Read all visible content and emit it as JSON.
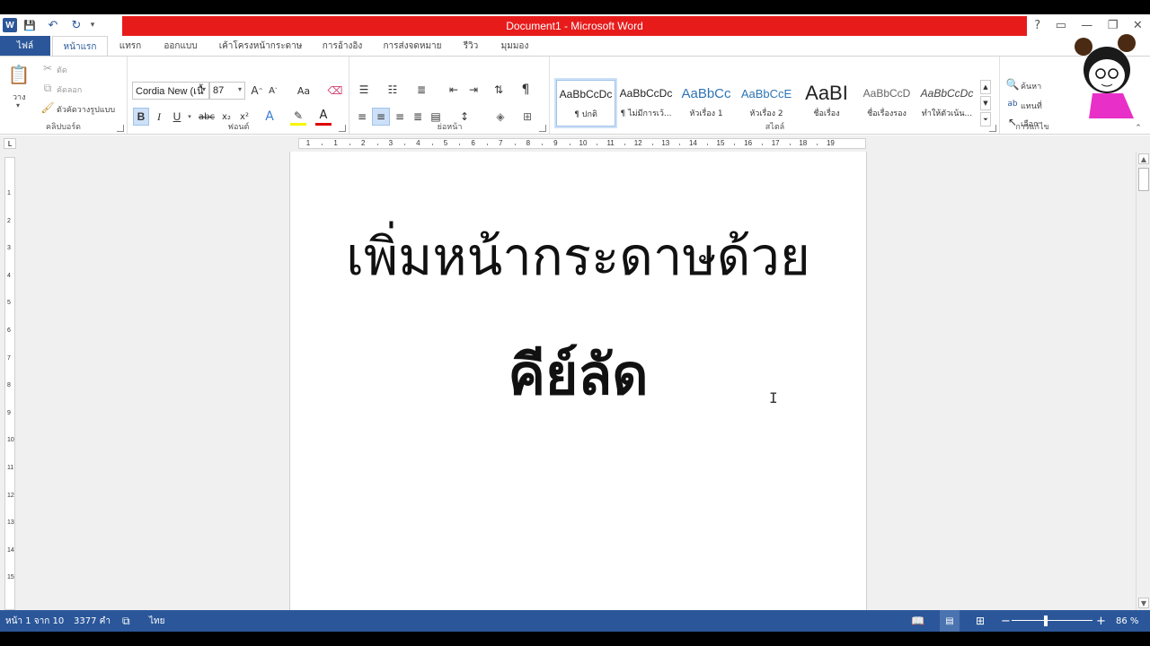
{
  "window": {
    "title": "Document1 - Microsoft Word",
    "help": "?",
    "controls": [
      "▭",
      "—",
      "❐",
      "✕"
    ]
  },
  "qat": {
    "logo": "W",
    "save": "💾",
    "undo": "↶",
    "redo": "↻",
    "more": "▾"
  },
  "tabs": {
    "file": "ไฟล์",
    "home": "หน้าแรก",
    "insert": "แทรก",
    "design": "ออกแบบ",
    "layout": "เค้าโครงหน้ากระดาษ",
    "references": "การอ้างอิง",
    "mailings": "การส่งจดหมาย",
    "review": "รีวิว",
    "view": "มุมมอง"
  },
  "ribbon": {
    "clipboard": {
      "label": "คลิปบอร์ด",
      "paste": "วาง",
      "cut": "ตัด",
      "copy": "คัดลอก",
      "format_painter": "ตัวคัดวางรูปแบบ"
    },
    "font": {
      "label": "ฟอนต์",
      "font_name": "Cordia New (เนื้",
      "font_size": "87",
      "grow": "A",
      "shrink": "A",
      "case": "Aa",
      "bold": "B",
      "italic": "I",
      "underline": "U",
      "strike": "abc",
      "subscript": "x₂",
      "superscript": "x²",
      "effects": "A",
      "font_color": "A"
    },
    "paragraph": {
      "label": "ย่อหน้า",
      "pilcrow": "¶"
    },
    "styles": {
      "label": "สไตล์",
      "items": [
        {
          "preview": "AaBbCcDc",
          "name": "¶ ปกติ"
        },
        {
          "preview": "AaBbCcDc",
          "name": "¶ ไม่มีการเว้..."
        },
        {
          "preview": "AaBbCc",
          "name": "หัวเรื่อง 1"
        },
        {
          "preview": "AaBbCcE",
          "name": "หัวเรื่อง 2"
        },
        {
          "preview": "AaBI",
          "name": "ชื่อเรื่อง"
        },
        {
          "preview": "AaBbCcD",
          "name": "ชื่อเรื่องรอง"
        },
        {
          "preview": "AaBbCcDc",
          "name": "ทำให้ตัวเน้น..."
        }
      ]
    },
    "editing": {
      "label": "การแก้ไข",
      "find": "ค้นหา",
      "replace": "แทนที่",
      "select": "เลือก"
    }
  },
  "ruler": {
    "tab_selector": "L",
    "h_numbers": [
      "1",
      "1",
      "2",
      "3",
      "4",
      "5",
      "6",
      "7",
      "8",
      "9",
      "10",
      "11",
      "12",
      "13",
      "14",
      "15",
      "16",
      "17",
      "18",
      "19"
    ],
    "v_numbers": [
      "1",
      "2",
      "3",
      "4",
      "5",
      "6",
      "7",
      "8",
      "9",
      "10",
      "11",
      "12",
      "13",
      "14",
      "15"
    ]
  },
  "document": {
    "line1": "เพิ่มหน้ากระดาษด้วย",
    "line2": "คีย์ลัด"
  },
  "status": {
    "page": "หน้า 1 จาก 10",
    "words": "3377 คำ",
    "language": "ไทย",
    "zoom": "86 %",
    "zoom_minus": "−",
    "zoom_plus": "+"
  },
  "colors": {
    "accent": "#2b579a",
    "title_bar": "#e81b1b"
  }
}
